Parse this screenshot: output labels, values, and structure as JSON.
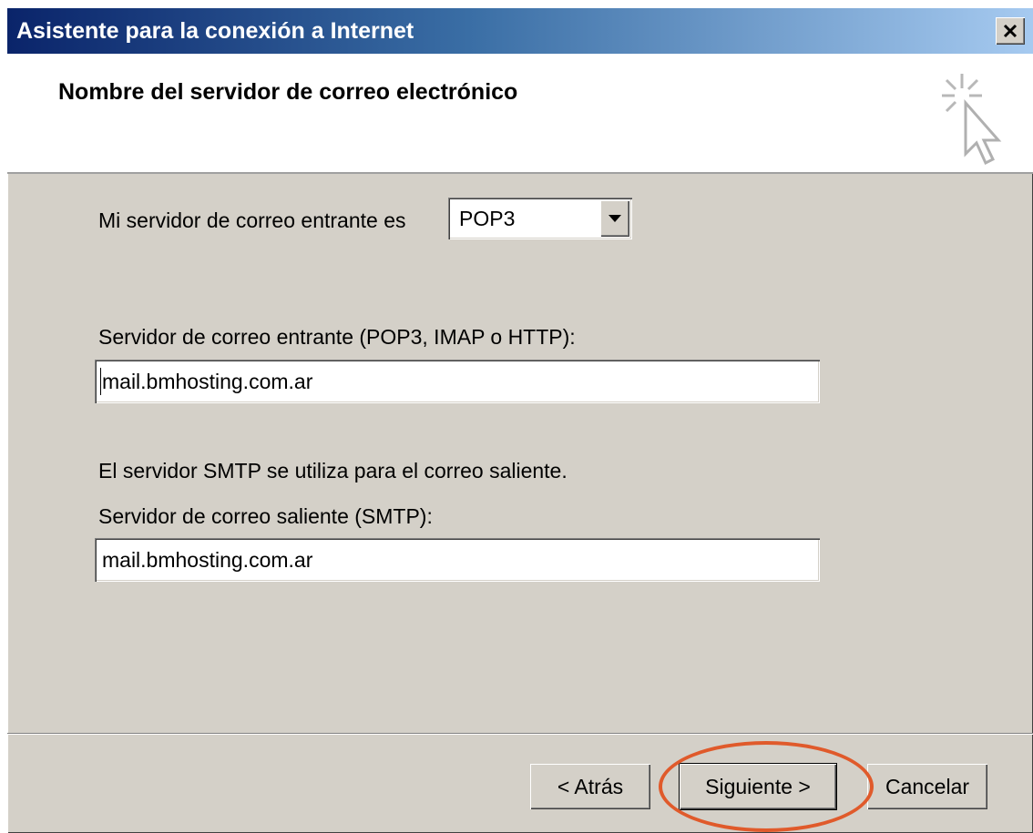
{
  "window": {
    "title": "Asistente para la conexión a Internet",
    "close_label": "✕"
  },
  "header": {
    "title": "Nombre del servidor de correo electrónico",
    "icon": "wizard-cursor-icon"
  },
  "form": {
    "incoming_type_label": "Mi servidor de correo entrante es",
    "incoming_type_value": "POP3",
    "incoming_server_label": "Servidor de correo entrante (POP3, IMAP o HTTP):",
    "incoming_server_value": "mail.bmhosting.com.ar",
    "smtp_info": "El servidor SMTP se utiliza para el correo saliente.",
    "outgoing_server_label": "Servidor de correo saliente (SMTP):",
    "outgoing_server_value": "mail.bmhosting.com.ar"
  },
  "buttons": {
    "back": "< Atrás",
    "next": "Siguiente >",
    "cancel": "Cancelar"
  },
  "colors": {
    "highlight": "#e05a2b",
    "titlebar_start": "#0a246a",
    "titlebar_end": "#a6caf0",
    "dialog_bg": "#d4d0c8"
  }
}
